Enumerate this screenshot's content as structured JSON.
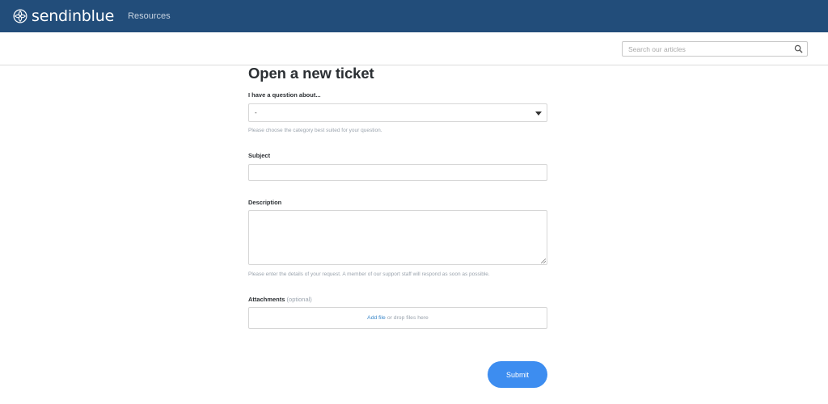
{
  "header": {
    "brand_name": "sendinblue",
    "brand_icon": "sendinblue-logo-icon",
    "nav": [
      {
        "label": "Resources"
      }
    ],
    "background_color": "#224d7a"
  },
  "search": {
    "placeholder": "Search our articles",
    "value": "",
    "icon": "search-icon"
  },
  "form": {
    "title": "Open a new ticket",
    "category": {
      "label": "I have a question about...",
      "selected": "-",
      "hint": "Please choose the category best suited for your question.",
      "icon": "caret-down-icon"
    },
    "subject": {
      "label": "Subject",
      "value": ""
    },
    "description": {
      "label": "Description",
      "value": "",
      "hint": "Please enter the details of your request. A member of our support staff will respond as soon as possible."
    },
    "attachments": {
      "label": "Attachments",
      "optional_label": "(optional)",
      "add_file": "Add file",
      "drop_text": "or drop files here"
    },
    "submit_label": "Submit",
    "submit_color": "#3d8df0"
  }
}
